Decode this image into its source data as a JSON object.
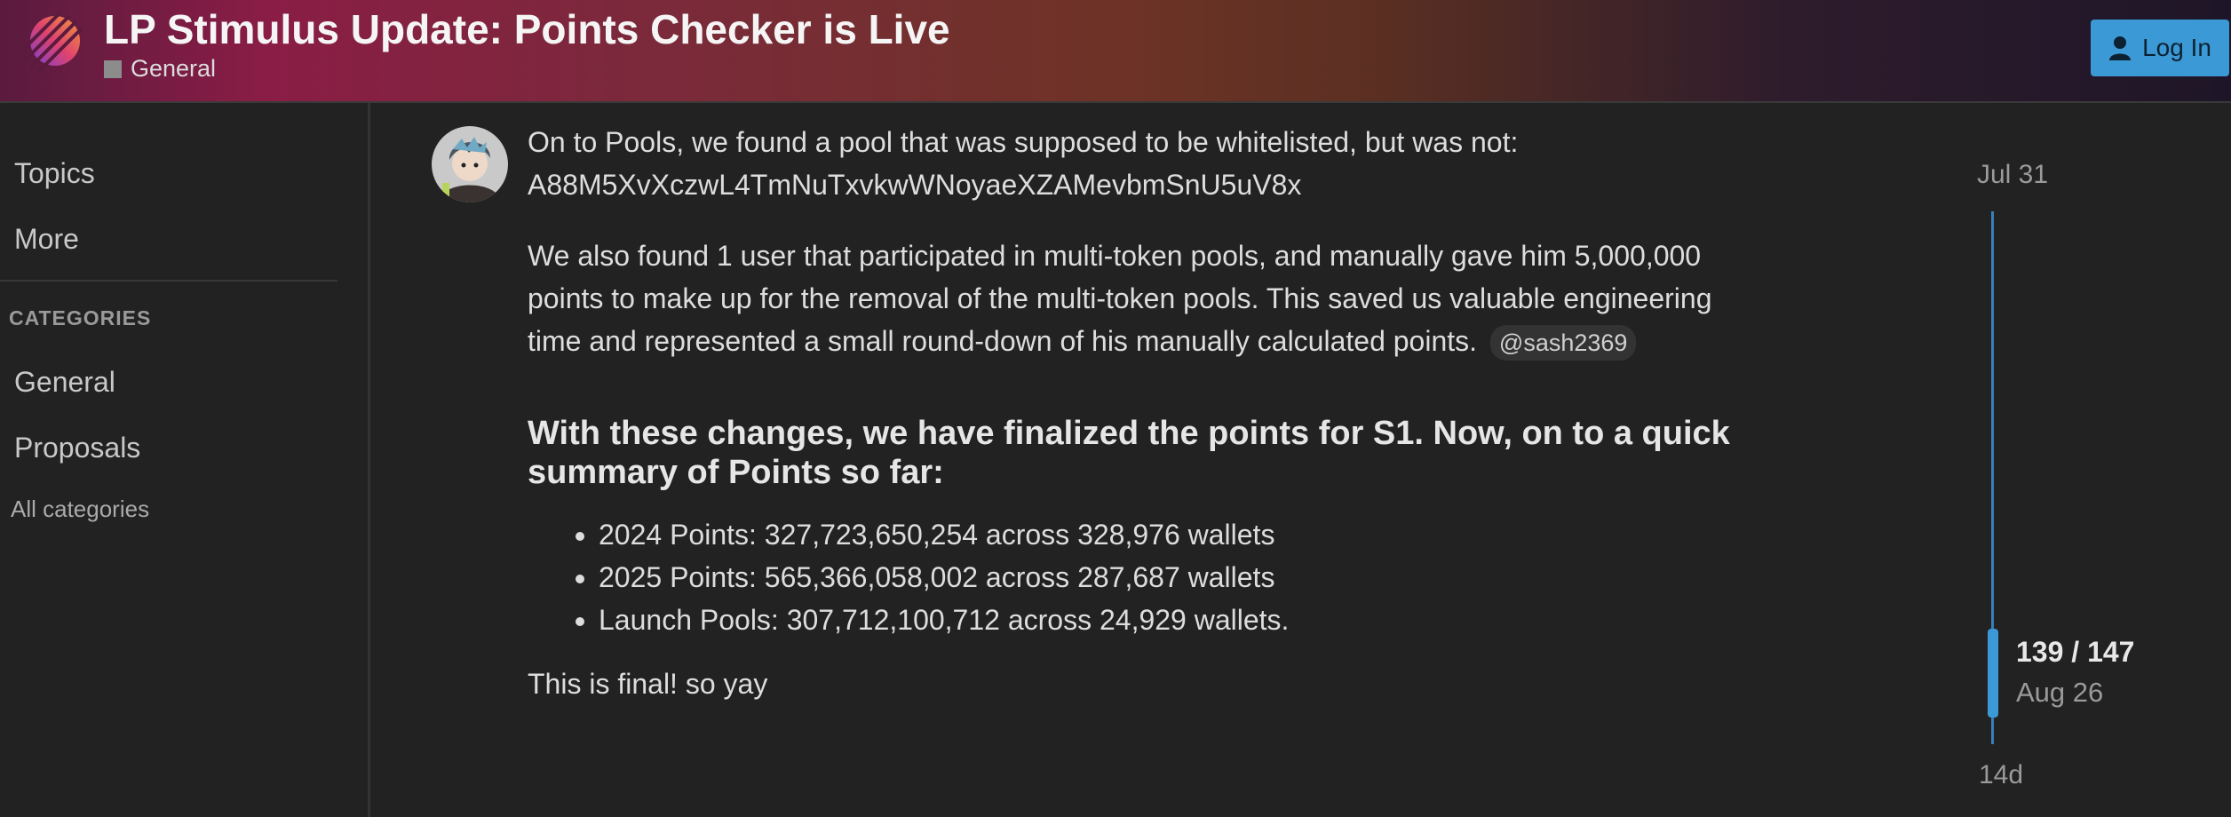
{
  "header": {
    "title": "LP Stimulus Update: Points Checker is Live",
    "category": "General",
    "login_label": "Log In"
  },
  "sidebar": {
    "nav": [
      "Topics",
      "More"
    ],
    "categories_heading": "CATEGORIES",
    "categories": [
      "General",
      "Proposals"
    ],
    "all_categories": "All categories"
  },
  "post": {
    "para1_line1": "On to Pools, we found a pool that was supposed to be whitelisted, but was not:",
    "para1_line2": "A88M5XvXczwL4TmNuTxvkwWNoyaeXZAMevbmSnU5uV8x",
    "para2": "We also found 1 user that participated in multi-token pools, and manually gave him 5,000,000 points to make up for the removal of the multi-token pools. This saved us valuable engineering time and represented a small round-down of his manually calculated points.",
    "mention": "@sash2369",
    "heading": "With these changes, we have finalized the points for S1. Now, on to a quick summary of Points so far:",
    "bullets": [
      "2024 Points: 327,723,650,254 across 328,976 wallets",
      "2025 Points: 565,366,058,002 across 287,687 wallets",
      "Launch Pools: 307,712,100,712 across 24,929 wallets."
    ],
    "closing": "This is final! so yay"
  },
  "timeline": {
    "start_date": "Jul 31",
    "position": "139 / 147",
    "current_date": "Aug 26",
    "end_label": "14d",
    "progress_fraction": 0.946
  },
  "colors": {
    "accent": "#3b99d5",
    "background": "#222222",
    "category_square": "#8c8c8c"
  }
}
